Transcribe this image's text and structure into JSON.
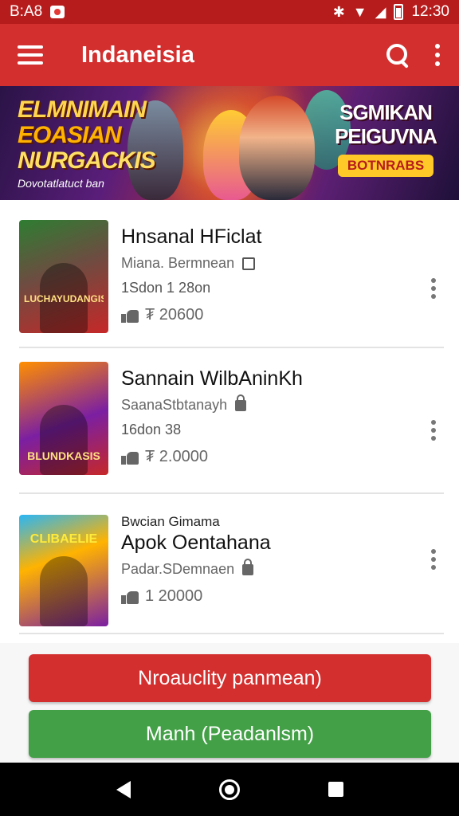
{
  "status_bar": {
    "time_left": "B:A8",
    "time_right": "12:30"
  },
  "app_bar": {
    "title": "Indaneisia"
  },
  "banner": {
    "left_line1": "ELMNIMAIN",
    "left_line2": "EOASIAN",
    "left_line3": "NURGACKIS",
    "left_small": "Dovotatlatuct ban",
    "right_line1": "SGMIKAN",
    "right_line2": "PEIGUVNA",
    "cta_label": "BOTNRABS"
  },
  "items": [
    {
      "title": "Hnsanal HFiclat",
      "author": "Miana. Bermnean",
      "date": "1Sdon 1 28on",
      "likes": "₮ 20600",
      "thumb_title": "LUCHAYUDANGIS"
    },
    {
      "title": "Sannain WilbAninKh",
      "author": "SaanaStbtanayh",
      "date": "16don 38",
      "likes": "₮ 2.0000",
      "thumb_title": "BLUNDKASIS"
    },
    {
      "kicker": "Bwcian Gimama",
      "title": "Apok Oentahana",
      "author": "Padar.SDemnaen",
      "likes": "1 20000",
      "thumb_title": "CLIBAELIE"
    }
  ],
  "buttons": {
    "primary_label": "Nroauclity panmean)",
    "secondary_label": "Manh (Peadanlsm)"
  },
  "colors": {
    "status_bar": "#b71c1c",
    "app_bar": "#d32f2f",
    "primary_button": "#d32f2f",
    "secondary_button": "#43a047",
    "nav_bar": "#000000"
  },
  "icons": {
    "menu": "menu-icon",
    "search": "search-icon",
    "more": "more-vert-icon",
    "like": "thumb-up-icon",
    "back": "back-icon",
    "home": "home-icon",
    "recents": "recents-icon"
  }
}
